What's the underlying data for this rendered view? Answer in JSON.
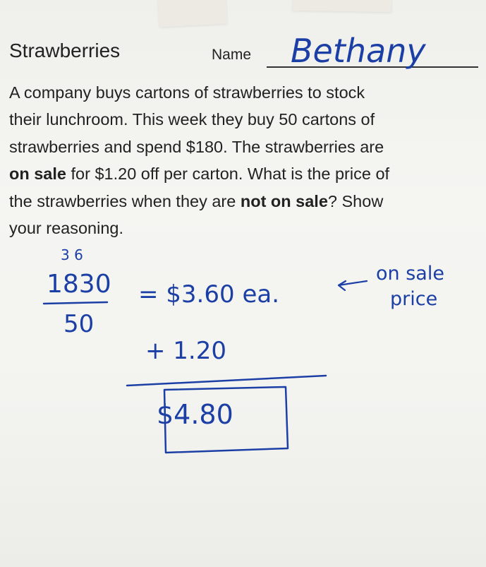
{
  "worksheet": {
    "title": "Strawberries",
    "name_label": "Name",
    "student_name": "Bethany",
    "problem_lines": [
      {
        "parts": [
          {
            "text": "A company buys cartons of strawberries to stock",
            "bold": false
          }
        ]
      },
      {
        "parts": [
          {
            "text": "their lunchroom. This week they buy 50 cartons of",
            "bold": false
          }
        ]
      },
      {
        "parts": [
          {
            "text": "strawberries and spend $180. The strawberries are",
            "bold": false
          }
        ]
      },
      {
        "parts": [
          {
            "text": "on sale",
            "bold": true
          },
          {
            "text": " for $1.20 off per carton. What is the price of",
            "bold": false
          }
        ]
      },
      {
        "parts": [
          {
            "text": "the strawberries when they are ",
            "bold": false
          },
          {
            "text": "not on sale",
            "bold": true
          },
          {
            "text": "? Show",
            "bold": false
          }
        ]
      },
      {
        "parts": [
          {
            "text": "your reasoning.",
            "bold": false
          }
        ]
      }
    ]
  },
  "handwritten_work": {
    "ink_color": "#1c3fa6",
    "scratch_digits": "3 6",
    "numerator": "1830",
    "denominator": "50",
    "equals_result": "= $3.60 ea.",
    "annotation_line1": "on sale",
    "annotation_line2": "price",
    "addend": "+ 1.20",
    "final_answer": "$4.80"
  }
}
